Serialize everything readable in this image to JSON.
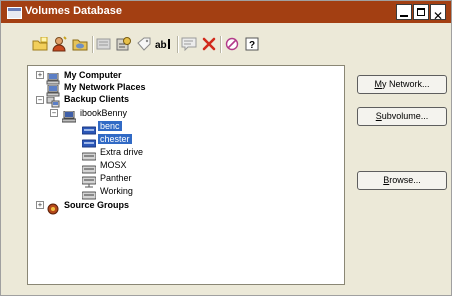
{
  "window": {
    "title": "Volumes Database"
  },
  "toolbar": {
    "tools": [
      "new-volume-icon",
      "add-user-icon",
      "folder-open-icon",
      "properties-grey-icon",
      "settings-icon",
      "tag-icon",
      "rename-icon",
      "comment-icon",
      "delete-icon",
      "erase-icon",
      "help-icon"
    ]
  },
  "tree": {
    "my_computer": "My Computer",
    "my_network_places": "My Network Places",
    "backup_clients": "Backup Clients",
    "ibookbenny": "ibookBenny",
    "benc": "benc",
    "chester": "chester",
    "extra_drive": "Extra drive",
    "mosx": "MOSX",
    "panther": "Panther",
    "working": "Working",
    "source_groups": "Source Groups"
  },
  "buttons": {
    "my_network_u": "M",
    "my_network_rest": "y Network...",
    "subvolume_u": "S",
    "subvolume_rest": "ubvolume...",
    "browse_u": "B",
    "browse_rest": "rowse..."
  },
  "colors": {
    "titlebar": "#a33f12",
    "selection": "#316ac5",
    "window_bg": "#ece9d8"
  }
}
